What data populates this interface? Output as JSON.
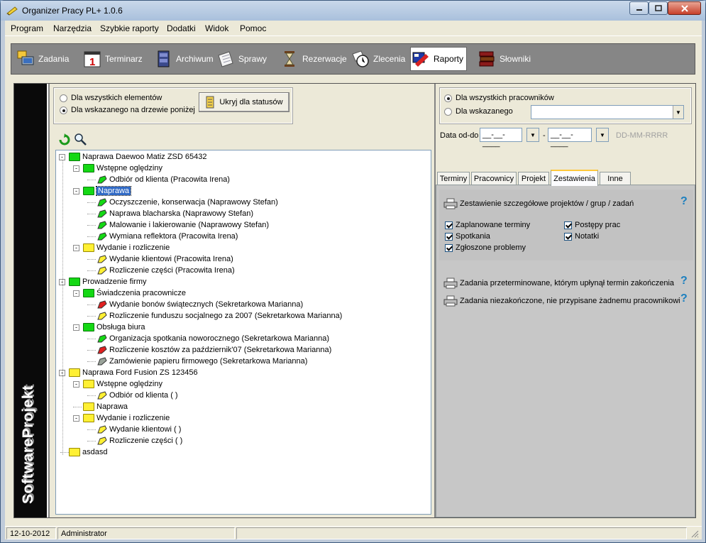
{
  "window": {
    "title": "Organizer Pracy PL+ 1.0.6"
  },
  "menu": [
    "Program",
    "Narzędzia",
    "Szybkie raporty",
    "Dodatki",
    "Widok",
    "Pomoc"
  ],
  "toolbar": [
    {
      "label": "Zadania",
      "icon": "computer-icon"
    },
    {
      "label": "Terminarz",
      "icon": "calendar-icon"
    },
    {
      "label": "Archiwum",
      "icon": "cabinet-icon"
    },
    {
      "label": "Sprawy",
      "icon": "notepad-icon"
    },
    {
      "label": "Rezerwacje",
      "icon": "hourglass-icon"
    },
    {
      "label": "Zlecenia",
      "icon": "clock-icon"
    },
    {
      "label": "Raporty",
      "icon": "report-icon",
      "active": true
    },
    {
      "label": "Słowniki",
      "icon": "books-icon"
    }
  ],
  "sidebar": {
    "brand": "SoftwareProjekt"
  },
  "filter": {
    "all_elements": "Dla wszystkich elementów",
    "selected_tree": "Dla wskazanego na drzewie poniżej",
    "hide_status_button": "Ukryj dla statusów"
  },
  "tree": [
    {
      "label": "Naprawa Daewoo Matiz ZSD 65432",
      "type": "folder",
      "color": "green",
      "level": 0,
      "exp": "-"
    },
    {
      "label": "Wstępne oględziny",
      "type": "folder",
      "color": "green",
      "level": 1,
      "exp": "-"
    },
    {
      "label": "Odbiór od klienta (Pracowita Irena)",
      "type": "task",
      "color": "green",
      "level": 2
    },
    {
      "label": "Naprawa",
      "type": "folder",
      "color": "green",
      "level": 1,
      "exp": "-",
      "selected": true
    },
    {
      "label": "Oczyszczenie, konserwacja (Naprawowy Stefan)",
      "type": "task",
      "color": "green",
      "level": 2
    },
    {
      "label": "Naprawa blacharska (Naprawowy Stefan)",
      "type": "task",
      "color": "green",
      "level": 2
    },
    {
      "label": "Malowanie i lakierowanie (Naprawowy Stefan)",
      "type": "task",
      "color": "green",
      "level": 2
    },
    {
      "label": "Wymiana reflektora (Pracowita Irena)",
      "type": "task",
      "color": "green",
      "level": 2
    },
    {
      "label": "Wydanie i rozliczenie",
      "type": "folder",
      "color": "yellow",
      "level": 1,
      "exp": "-"
    },
    {
      "label": "Wydanie klientowi (Pracowita Irena)",
      "type": "task",
      "color": "yellow",
      "level": 2
    },
    {
      "label": "Rozliczenie części (Pracowita Irena)",
      "type": "task",
      "color": "yellow",
      "level": 2
    },
    {
      "label": "Prowadzenie firmy",
      "type": "folder",
      "color": "green",
      "level": 0,
      "exp": "-"
    },
    {
      "label": "Świadczenia pracownicze",
      "type": "folder",
      "color": "green",
      "level": 1,
      "exp": "-"
    },
    {
      "label": "Wydanie bonów świątecznych (Sekretarkowa Marianna)",
      "type": "task",
      "color": "red",
      "level": 2
    },
    {
      "label": "Rozliczenie funduszu socjalnego za 2007 (Sekretarkowa Marianna)",
      "type": "task",
      "color": "yellow",
      "level": 2
    },
    {
      "label": "Obsługa biura",
      "type": "folder",
      "color": "green",
      "level": 1,
      "exp": "-"
    },
    {
      "label": "Organizacja spotkania noworocznego (Sekretarkowa Marianna)",
      "type": "task",
      "color": "green",
      "level": 2
    },
    {
      "label": "Rozliczenie kosztów za październik'07 (Sekretarkowa Marianna)",
      "type": "task",
      "color": "red",
      "level": 2
    },
    {
      "label": "Zamówienie papieru firmowego (Sekretarkowa Marianna)",
      "type": "task",
      "color": "grey",
      "level": 2
    },
    {
      "label": "Naprawa Ford Fusion ZS 123456",
      "type": "folder",
      "color": "yellow",
      "level": 0,
      "exp": "-"
    },
    {
      "label": "Wstępne oględziny",
      "type": "folder",
      "color": "yellow",
      "level": 1,
      "exp": "-"
    },
    {
      "label": "Odbiór od klienta ( )",
      "type": "task",
      "color": "yellow",
      "level": 2
    },
    {
      "label": "Naprawa",
      "type": "folder",
      "color": "yellow",
      "level": 1
    },
    {
      "label": "Wydanie i rozliczenie",
      "type": "folder",
      "color": "yellow",
      "level": 1,
      "exp": "-"
    },
    {
      "label": "Wydanie klientowi ( )",
      "type": "task",
      "color": "yellow",
      "level": 2
    },
    {
      "label": "Rozliczenie części ( )",
      "type": "task",
      "color": "yellow",
      "level": 2
    },
    {
      "label": "asdasd",
      "type": "folder",
      "color": "yellow",
      "level": 0
    }
  ],
  "employee_filter": {
    "all_employees": "Dla wszystkich pracowników",
    "selected_employee": "Dla wskazanego",
    "selected_value": "",
    "date_label": "Data od-do",
    "date_from": "__-__-____",
    "date_sep": "-",
    "date_to": "__-__-____",
    "date_format": "DD-MM-RRRR"
  },
  "tabs": [
    "Terminy",
    "Pracownicy",
    "Projekt",
    "Zestawienia",
    "Inne"
  ],
  "active_tab": "Zestawienia",
  "reports": {
    "detailed_title": "Zestawienie szczegółowe projektów / grup / zadań",
    "checks": [
      {
        "label": "Zaplanowane terminy",
        "checked": true
      },
      {
        "label": "Postępy prac",
        "checked": true
      },
      {
        "label": "Spotkania",
        "checked": true
      },
      {
        "label": "Notatki",
        "checked": true
      },
      {
        "label": "Zgłoszone problemy",
        "checked": true
      }
    ],
    "overdue": "Zadania przeterminowane, którym upłynął termin zakończenia",
    "unassigned": "Zadania niezakończone, nie przypisane żadnemu pracownikowi",
    "help": "?"
  },
  "status": {
    "date": "12-10-2012",
    "user": "Administrator",
    "info": ""
  },
  "colors": {
    "toolbar": "#868686",
    "selection": "#316ac5",
    "green": "#14d814",
    "yellow": "#fff033",
    "help": "#1b7fbf"
  }
}
